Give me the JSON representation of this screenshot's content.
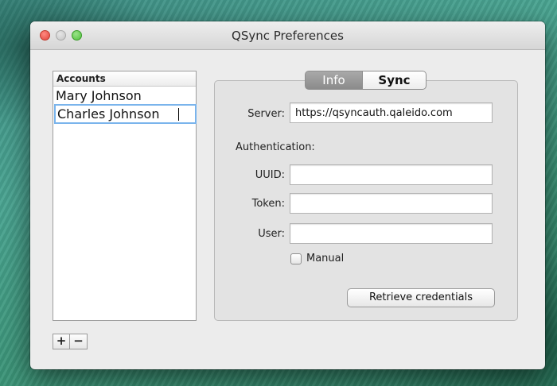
{
  "window": {
    "title": "QSync Preferences",
    "traffic_lights": {
      "close": "#e0443e",
      "minimize": "#c4c4c4",
      "maximize": "#4fc13a"
    }
  },
  "accounts": {
    "header": "Accounts",
    "items": [
      {
        "label": "Mary Johnson"
      },
      {
        "label": "Charles Johnson",
        "editing": true
      }
    ],
    "add_label": "+",
    "remove_label": "−"
  },
  "tabs": [
    {
      "label": "Info",
      "active": true
    },
    {
      "label": "Sync",
      "active": false
    }
  ],
  "info": {
    "server_label": "Server:",
    "server_value": "https://qsyncauth.qaleido.com",
    "auth_label": "Authentication:",
    "uuid_label": "UUID:",
    "uuid_value": "",
    "token_label": "Token:",
    "token_value": "",
    "user_label": "User:",
    "user_value": "",
    "manual_label": "Manual",
    "manual_checked": false,
    "retrieve_label": "Retrieve credentials"
  }
}
